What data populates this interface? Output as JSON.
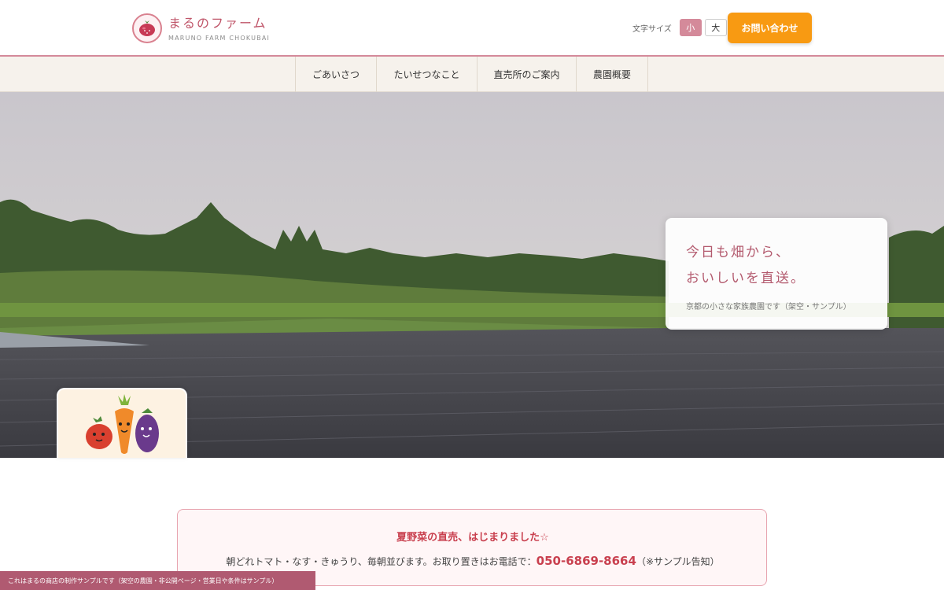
{
  "header": {
    "logo_title": "まるのファーム",
    "logo_sub": "MARUNO FARM CHOKUBAI",
    "font_size_label": "文字サイズ",
    "font_small": "小",
    "font_large": "大",
    "contact_label": "お問い合わせ"
  },
  "nav": {
    "items": [
      {
        "label": "ごあいさつ"
      },
      {
        "label": "たいせつなこと"
      },
      {
        "label": "直売所のご案内"
      },
      {
        "label": "農園概要"
      }
    ]
  },
  "hero": {
    "line1": "今日も畑から、",
    "line2": "おいしいを直送。",
    "sub": "京都の小さな家族農園です（架空・サンプル）"
  },
  "notice": {
    "title": "夏野菜の直売、はじまりました☆",
    "body": "朝どれトマト・なす・きゅうり、毎朝並びます。お取り置きはお電話で：",
    "phone": "050-6869-8664",
    "note": "（※サンプル告知）"
  },
  "banner": {
    "text": "これはまるの商店の制作サンプルです（架空の農園・非公開ページ・営業日や条件はサンプル）"
  },
  "colors": {
    "brand_pink": "#c0566a",
    "accent_orange": "#f89a12",
    "notice_red": "#c9404f",
    "nav_bg": "#f6f2ec"
  },
  "icons": {
    "logo": "tomato-icon",
    "veggies": "vegetable-characters-illustration"
  }
}
